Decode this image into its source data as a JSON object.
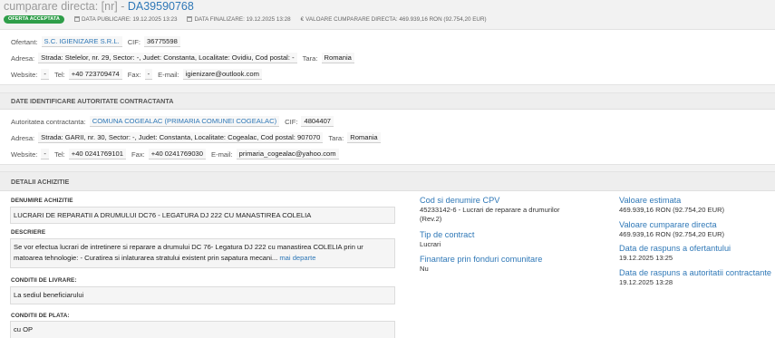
{
  "header": {
    "title_prefix": "cumparare directa: [nr] - ",
    "code": "DA39590768",
    "status": "OFERTA ACCEPTATA",
    "data_publicare": "DATA PUBLICARE: 19.12.2025 13:23",
    "data_finalizare": "DATA FINALIZARE: 19.12.2025 13:28",
    "valoare": "VALOARE CUMPARARE DIRECTA: 469.939,16  RON (92.754,20  EUR)"
  },
  "ofertant": {
    "label": "Ofertant:",
    "name": "S.C. IGIENIZARE S.R.L.",
    "cif_label": "CIF:",
    "cif": "36775598",
    "adresa_label": "Adresa:",
    "adresa": "Strada: Stelelor, nr. 29, Sector: -, Judet: Constanta, Localitate: Ovidiu, Cod postal: -",
    "tara_label": "Tara:",
    "tara": "Romania",
    "website_label": "Website:",
    "website": "-",
    "tel_label": "Tel:",
    "tel": "+40 723709474",
    "fax_label": "Fax:",
    "fax": "-",
    "email_label": "E-mail:",
    "email": "igienizare@outlook.com"
  },
  "autoritate": {
    "header": "DATE IDENTIFICARE AUTORITATE CONTRACTANTA",
    "label": "Autoritatea contractanta:",
    "name": "COMUNA COGEALAC (PRIMARIA COMUNEI COGEALAC)",
    "cif_label": "CIF:",
    "cif": "4804407",
    "adresa_label": "Adresa:",
    "adresa": "Strada: GARII, nr. 30, Sector: -, Judet: Constanta, Localitate: Cogealac, Cod postal: 907070",
    "tara_label": "Tara:",
    "tara": "Romania",
    "website_label": "Website:",
    "website": "-",
    "tel_label": "Tel:",
    "tel": "+40 0241769101",
    "fax_label": "Fax:",
    "fax": "+40 0241769030",
    "email_label": "E-mail:",
    "email": "primaria_cogealac@yahoo.com"
  },
  "detalii": {
    "header": "DETALII ACHIZITIE",
    "denumire_label": "DENUMIRE ACHIZITIE",
    "denumire": "LUCRARI DE REPARATII A DRUMULUI DC76 - LEGATURA DJ 222 CU MANASTIREA COLELIA",
    "descriere_label": "DESCRIERE",
    "descriere_1": "Se vor efectua lucrari de intretinere si reparare a drumului DC 76- Legatura DJ 222 cu manastirea COLELIA prin ur",
    "descriere_2": "matoarea tehnologie: - Curatirea si inlaturarea stratului existent prin sapatura mecani... ",
    "mai_departe": "mai departe",
    "livrare_label": "CONDITII DE LIVRARE:",
    "livrare": "La sediul beneficiarului",
    "plata_label": "CONDITII DE PLATA:",
    "plata": "cu OP",
    "cpv_title": "Cod si denumire CPV",
    "cpv_1": "45233142-6 - Lucrari de reparare a drumurilor",
    "cpv_2": "(Rev.2)",
    "tip_title": "Tip de contract",
    "tip": "Lucrari",
    "fin_title": "Finantare prin fonduri comunitare",
    "fin": "Nu",
    "est_title": "Valoare estimata",
    "est": "469.939,16  RON (92.754,20  EUR)",
    "vcd_title": "Valoare cumparare directa",
    "vcd": "469.939,16  RON (92.754,20  EUR)",
    "rasp_of_title": "Data de raspuns a ofertantului",
    "rasp_of": "19.12.2025 13:25",
    "rasp_aut_title": "Data de raspuns a autoritatii contractante",
    "rasp_aut": "19.12.2025 13:28"
  }
}
